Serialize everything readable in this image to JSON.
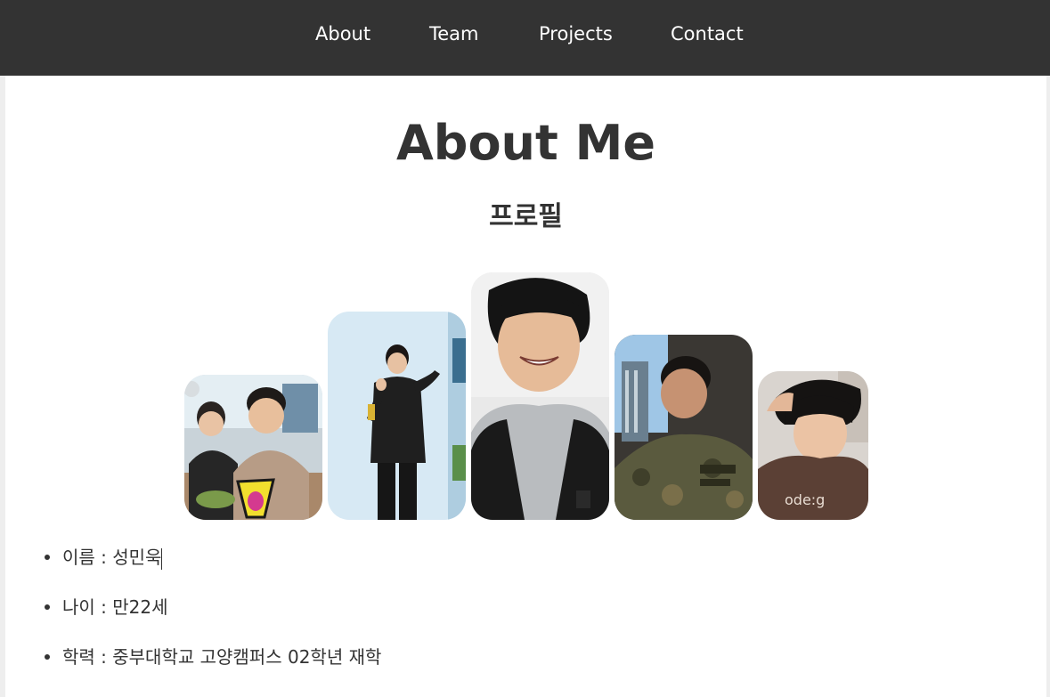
{
  "nav": {
    "links": [
      {
        "label": "About"
      },
      {
        "label": "Team"
      },
      {
        "label": "Projects"
      },
      {
        "label": "Contact"
      }
    ]
  },
  "main": {
    "title": "About Me",
    "section_title": "프로필",
    "photos": [
      {
        "description": "photo-friends-restaurant"
      },
      {
        "description": "photo-black-outfit-pose"
      },
      {
        "description": "photo-hoodie-smiling"
      },
      {
        "description": "photo-military-uniform"
      },
      {
        "description": "photo-brown-shirt"
      }
    ],
    "info": [
      {
        "text": "이름 : 성민욱"
      },
      {
        "text": "나이 : 만22세"
      },
      {
        "text": "학력 : 중부대학교 고양캠퍼스 02학년 재학"
      }
    ]
  },
  "colors": {
    "navbar_bg": "#333333",
    "nav_text": "#ffffff",
    "content_bg": "#ffffff",
    "body_text": "#333333",
    "page_bg": "#eeeeee"
  }
}
